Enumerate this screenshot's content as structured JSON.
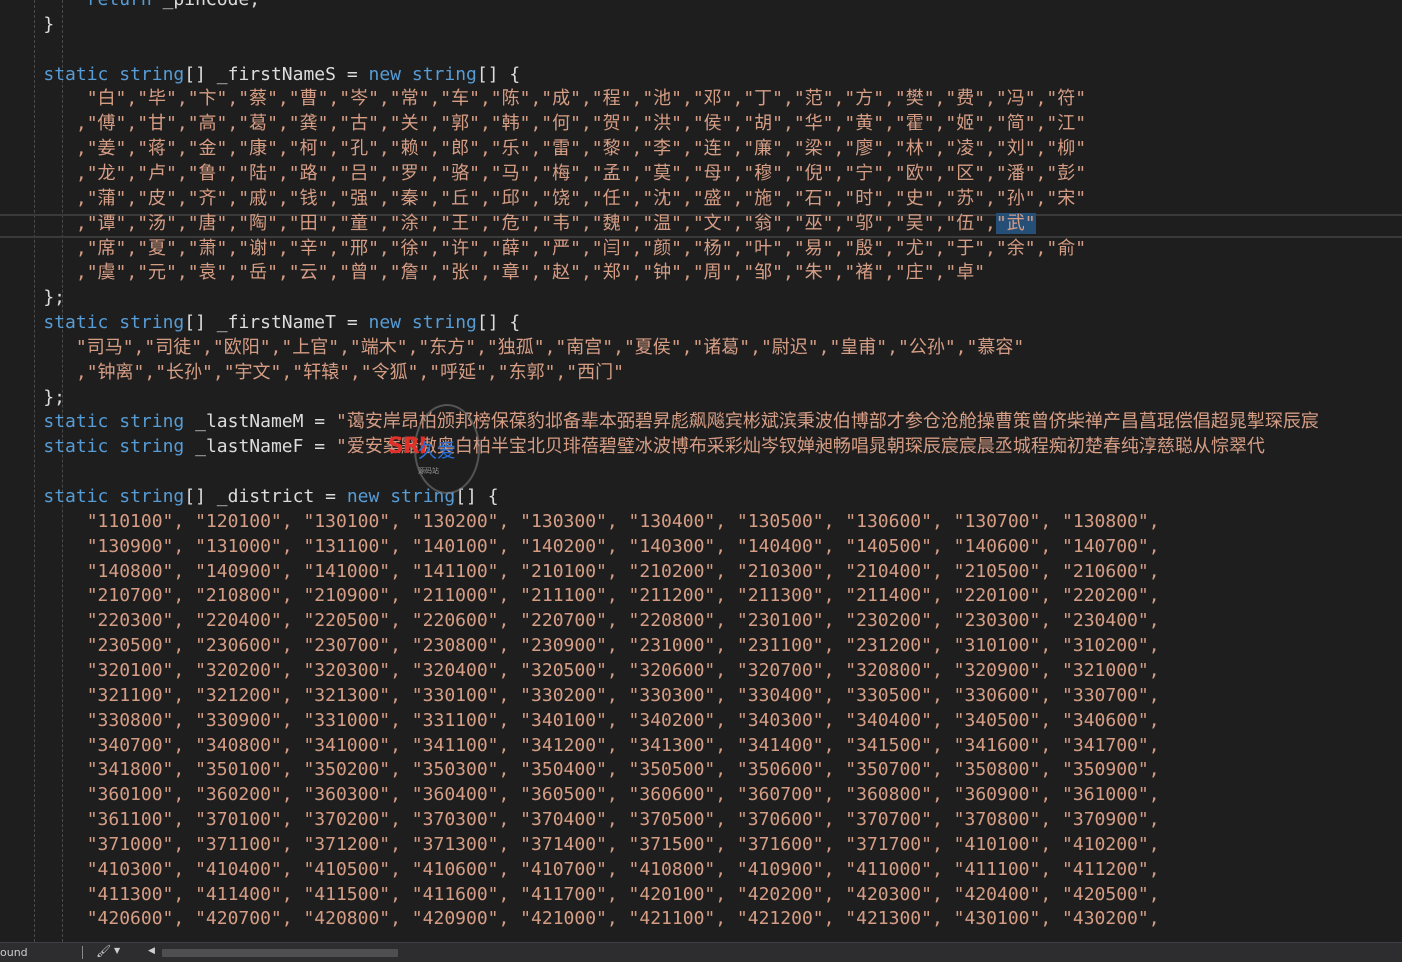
{
  "code_lines": [
    [
      {
        "c": "pl",
        "t": "        "
      },
      {
        "c": "kw",
        "t": "return"
      },
      {
        "c": "pl",
        "t": " _pinCode;"
      }
    ],
    [
      {
        "c": "pl",
        "t": "    }"
      }
    ],
    [
      {
        "c": "pl",
        "t": ""
      }
    ],
    [
      {
        "c": "pl",
        "t": "    "
      },
      {
        "c": "kw",
        "t": "static"
      },
      {
        "c": "pl",
        "t": " "
      },
      {
        "c": "kw",
        "t": "string"
      },
      {
        "c": "pl",
        "t": "[] _firstNameS = "
      },
      {
        "c": "kw",
        "t": "new"
      },
      {
        "c": "pl",
        "t": " "
      },
      {
        "c": "kw",
        "t": "string"
      },
      {
        "c": "pl",
        "t": "[] {"
      }
    ],
    [
      {
        "c": "pl",
        "t": "        "
      },
      {
        "c": "str",
        "t": "\"白\",\"毕\",\"卞\",\"蔡\",\"曹\",\"岑\",\"常\",\"车\",\"陈\",\"成\",\"程\",\"池\",\"邓\",\"丁\",\"范\",\"方\",\"樊\",\"费\",\"冯\",\"符\""
      }
    ],
    [
      {
        "c": "pl",
        "t": "       "
      },
      {
        "c": "str",
        "t": ",\"傅\",\"甘\",\"高\",\"葛\",\"龚\",\"古\",\"关\",\"郭\",\"韩\",\"何\",\"贺\",\"洪\",\"侯\",\"胡\",\"华\",\"黄\",\"霍\",\"姬\",\"简\",\"江\""
      }
    ],
    [
      {
        "c": "pl",
        "t": "       "
      },
      {
        "c": "str",
        "t": ",\"姜\",\"蒋\",\"金\",\"康\",\"柯\",\"孔\",\"赖\",\"郎\",\"乐\",\"雷\",\"黎\",\"李\",\"连\",\"廉\",\"梁\",\"廖\",\"林\",\"凌\",\"刘\",\"柳\""
      }
    ],
    [
      {
        "c": "pl",
        "t": "       "
      },
      {
        "c": "str",
        "t": ",\"龙\",\"卢\",\"鲁\",\"陆\",\"路\",\"吕\",\"罗\",\"骆\",\"马\",\"梅\",\"孟\",\"莫\",\"母\",\"穆\",\"倪\",\"宁\",\"欧\",\"区\",\"潘\",\"彭\""
      }
    ],
    [
      {
        "c": "pl",
        "t": "       "
      },
      {
        "c": "str",
        "t": ",\"蒲\",\"皮\",\"齐\",\"戚\",\"钱\",\"强\",\"秦\",\"丘\",\"邱\",\"饶\",\"任\",\"沈\",\"盛\",\"施\",\"石\",\"时\",\"史\",\"苏\",\"孙\",\"宋\""
      }
    ],
    [
      {
        "c": "pl",
        "t": "       "
      },
      {
        "c": "str",
        "t": ",\"谭\",\"汤\",\"唐\",\"陶\",\"田\",\"童\",\"涂\",\"王\",\"危\",\"韦\",\"魏\",\"温\",\"文\",\"翁\",\"巫\",\"邬\",\"吴\",\"伍\","
      },
      {
        "c": "str sel",
        "t": "\"武\""
      }
    ],
    [
      {
        "c": "pl",
        "t": "       "
      },
      {
        "c": "str",
        "t": ",\"席\",\"夏\",\"萧\",\"谢\",\"辛\",\"邢\",\"徐\",\"许\",\"薛\",\"严\",\"闫\",\"颜\",\"杨\",\"叶\",\"易\",\"殷\",\"尤\",\"于\",\"余\",\"俞\""
      }
    ],
    [
      {
        "c": "pl",
        "t": "       "
      },
      {
        "c": "str",
        "t": ",\"虞\",\"元\",\"袁\",\"岳\",\"云\",\"曾\",\"詹\",\"张\",\"章\",\"赵\",\"郑\",\"钟\",\"周\",\"邹\",\"朱\",\"褚\",\"庄\",\"卓\""
      }
    ],
    [
      {
        "c": "pl",
        "t": "    };"
      }
    ],
    [
      {
        "c": "pl",
        "t": "    "
      },
      {
        "c": "kw",
        "t": "static"
      },
      {
        "c": "pl",
        "t": " "
      },
      {
        "c": "kw",
        "t": "string"
      },
      {
        "c": "pl",
        "t": "[] _firstNameT = "
      },
      {
        "c": "kw",
        "t": "new"
      },
      {
        "c": "pl",
        "t": " "
      },
      {
        "c": "kw",
        "t": "string"
      },
      {
        "c": "pl",
        "t": "[] {"
      }
    ],
    [
      {
        "c": "pl",
        "t": "       "
      },
      {
        "c": "str",
        "t": "\"司马\",\"司徒\",\"欧阳\",\"上官\",\"端木\",\"东方\",\"独孤\",\"南宫\",\"夏侯\",\"诸葛\",\"尉迟\",\"皇甫\",\"公孙\",\"慕容\""
      }
    ],
    [
      {
        "c": "pl",
        "t": "       "
      },
      {
        "c": "str",
        "t": ",\"钟离\",\"长孙\",\"宇文\",\"轩辕\",\"令狐\",\"呼延\",\"东郭\",\"西门\""
      }
    ],
    [
      {
        "c": "pl",
        "t": "    };"
      }
    ],
    [
      {
        "c": "pl",
        "t": "    "
      },
      {
        "c": "kw",
        "t": "static"
      },
      {
        "c": "pl",
        "t": " "
      },
      {
        "c": "kw",
        "t": "string"
      },
      {
        "c": "pl",
        "t": " _lastNameM = "
      },
      {
        "c": "str",
        "t": "\"蔼安岸昂柏颁邦榜保葆豹邶备辈本弼碧昇彪飙飚宾彬斌滨秉波伯博部才参仓沧舱操曹策曾侪柴禅产昌菖琨偿倡超晁掣琛辰宸"
      }
    ],
    [
      {
        "c": "pl",
        "t": "    "
      },
      {
        "c": "kw",
        "t": "static"
      },
      {
        "c": "pl",
        "t": " "
      },
      {
        "c": "kw",
        "t": "string"
      },
      {
        "c": "pl",
        "t": " _lastNameF = "
      },
      {
        "c": "str",
        "t": "\"爱安案黯傲奥白柏半宝北贝琲蓓碧璧冰波博布采彩灿岑钗婵昶畅唱晁朝琛辰宸宸晨丞城程痴初楚春纯淳慈聪从悰翠代"
      }
    ],
    [
      {
        "c": "pl",
        "t": ""
      }
    ],
    [
      {
        "c": "pl",
        "t": "    "
      },
      {
        "c": "kw",
        "t": "static"
      },
      {
        "c": "pl",
        "t": " "
      },
      {
        "c": "kw",
        "t": "string"
      },
      {
        "c": "pl",
        "t": "[] _district = "
      },
      {
        "c": "kw",
        "t": "new"
      },
      {
        "c": "pl",
        "t": " "
      },
      {
        "c": "kw",
        "t": "string"
      },
      {
        "c": "pl",
        "t": "[] {"
      }
    ],
    [
      {
        "c": "pl",
        "t": "        "
      },
      {
        "c": "str",
        "t": "\"110100\", \"120100\", \"130100\", \"130200\", \"130300\", \"130400\", \"130500\", \"130600\", \"130700\", \"130800\","
      }
    ],
    [
      {
        "c": "pl",
        "t": "        "
      },
      {
        "c": "str",
        "t": "\"130900\", \"131000\", \"131100\", \"140100\", \"140200\", \"140300\", \"140400\", \"140500\", \"140600\", \"140700\","
      }
    ],
    [
      {
        "c": "pl",
        "t": "        "
      },
      {
        "c": "str",
        "t": "\"140800\", \"140900\", \"141000\", \"141100\", \"210100\", \"210200\", \"210300\", \"210400\", \"210500\", \"210600\","
      }
    ],
    [
      {
        "c": "pl",
        "t": "        "
      },
      {
        "c": "str",
        "t": "\"210700\", \"210800\", \"210900\", \"211000\", \"211100\", \"211200\", \"211300\", \"211400\", \"220100\", \"220200\","
      }
    ],
    [
      {
        "c": "pl",
        "t": "        "
      },
      {
        "c": "str",
        "t": "\"220300\", \"220400\", \"220500\", \"220600\", \"220700\", \"220800\", \"230100\", \"230200\", \"230300\", \"230400\","
      }
    ],
    [
      {
        "c": "pl",
        "t": "        "
      },
      {
        "c": "str",
        "t": "\"230500\", \"230600\", \"230700\", \"230800\", \"230900\", \"231000\", \"231100\", \"231200\", \"310100\", \"310200\","
      }
    ],
    [
      {
        "c": "pl",
        "t": "        "
      },
      {
        "c": "str",
        "t": "\"320100\", \"320200\", \"320300\", \"320400\", \"320500\", \"320600\", \"320700\", \"320800\", \"320900\", \"321000\","
      }
    ],
    [
      {
        "c": "pl",
        "t": "        "
      },
      {
        "c": "str",
        "t": "\"321100\", \"321200\", \"321300\", \"330100\", \"330200\", \"330300\", \"330400\", \"330500\", \"330600\", \"330700\","
      }
    ],
    [
      {
        "c": "pl",
        "t": "        "
      },
      {
        "c": "str",
        "t": "\"330800\", \"330900\", \"331000\", \"331100\", \"340100\", \"340200\", \"340300\", \"340400\", \"340500\", \"340600\","
      }
    ],
    [
      {
        "c": "pl",
        "t": "        "
      },
      {
        "c": "str",
        "t": "\"340700\", \"340800\", \"341000\", \"341100\", \"341200\", \"341300\", \"341400\", \"341500\", \"341600\", \"341700\","
      }
    ],
    [
      {
        "c": "pl",
        "t": "        "
      },
      {
        "c": "str",
        "t": "\"341800\", \"350100\", \"350200\", \"350300\", \"350400\", \"350500\", \"350600\", \"350700\", \"350800\", \"350900\","
      }
    ],
    [
      {
        "c": "pl",
        "t": "        "
      },
      {
        "c": "str",
        "t": "\"360100\", \"360200\", \"360300\", \"360400\", \"360500\", \"360600\", \"360700\", \"360800\", \"360900\", \"361000\","
      }
    ],
    [
      {
        "c": "pl",
        "t": "        "
      },
      {
        "c": "str",
        "t": "\"361100\", \"370100\", \"370200\", \"370300\", \"370400\", \"370500\", \"370600\", \"370700\", \"370800\", \"370900\","
      }
    ],
    [
      {
        "c": "pl",
        "t": "        "
      },
      {
        "c": "str",
        "t": "\"371000\", \"371100\", \"371200\", \"371300\", \"371400\", \"371500\", \"371600\", \"371700\", \"410100\", \"410200\","
      }
    ],
    [
      {
        "c": "pl",
        "t": "        "
      },
      {
        "c": "str",
        "t": "\"410300\", \"410400\", \"410500\", \"410600\", \"410700\", \"410800\", \"410900\", \"411000\", \"411100\", \"411200\","
      }
    ],
    [
      {
        "c": "pl",
        "t": "        "
      },
      {
        "c": "str",
        "t": "\"411300\", \"411400\", \"411500\", \"411600\", \"411700\", \"420100\", \"420200\", \"420300\", \"420400\", \"420500\","
      }
    ],
    [
      {
        "c": "pl",
        "t": "        "
      },
      {
        "c": "str",
        "t": "\"420600\", \"420700\", \"420800\", \"420900\", \"421000\", \"421100\", \"421200\", \"421300\", \"430100\", \"430200\","
      }
    ]
  ],
  "watermark": {
    "brand": "SRI",
    "brand2": "久爱",
    "sub": "源码站",
    "note": "logo"
  },
  "status_bar": {
    "text": "ound",
    "health_icon": "broom-icon"
  },
  "colors": {
    "background": "#1e1e1e",
    "keyword": "#569cd6",
    "string": "#d69d85",
    "plain": "#dcdcdc",
    "selection": "#264f78"
  }
}
